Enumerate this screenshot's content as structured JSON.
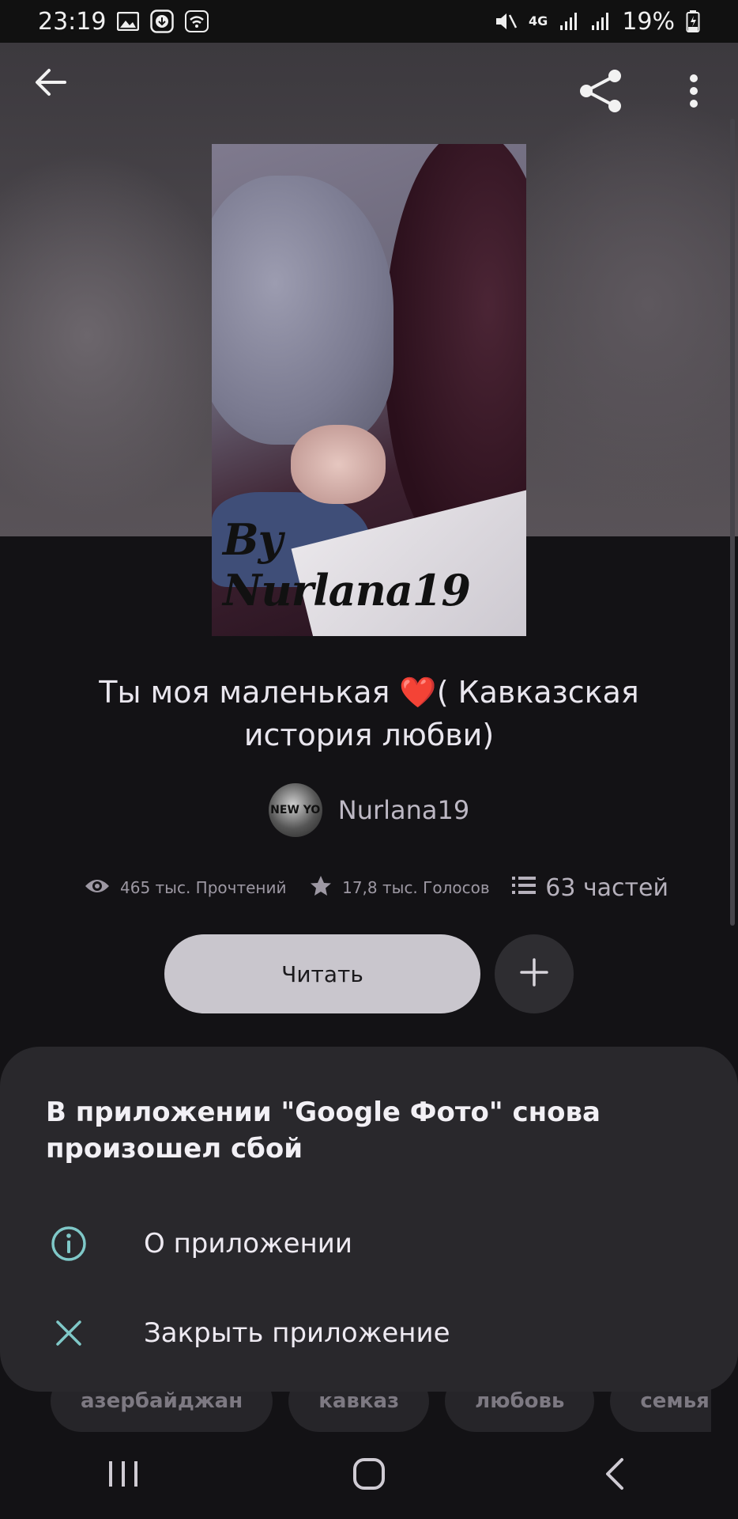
{
  "status_bar": {
    "time": "23:19",
    "left_icons": [
      "image-icon",
      "download-icon",
      "wifi-icon"
    ],
    "right_icons": [
      "mute-icon",
      "4g-icon",
      "signal-icon",
      "signal-icon",
      "battery-charging-icon"
    ],
    "network": "4G",
    "battery": "19%"
  },
  "top_bar": {
    "back_icon": "arrow-left-icon",
    "share_icon": "share-icon",
    "more_icon": "more-vertical-icon"
  },
  "cover": {
    "byline": "By Nurlana19"
  },
  "story": {
    "title": "Ты моя маленькая ❤️( Кавказская история любви)",
    "author": "Nurlana19",
    "avatar_text": "NEW YO"
  },
  "stats": {
    "reads": "465 тыс. Прочтений",
    "votes": "17,8 тыс. Голосов",
    "parts": "63 частей"
  },
  "actions": {
    "read_label": "Читать",
    "add_icon": "plus-icon"
  },
  "tags": [
    "азербайджан",
    "кавказ",
    "любовь",
    "семья"
  ],
  "dialog": {
    "title": "В приложении \"Google Фото\" снова произошел сбой",
    "items": [
      {
        "label": "О приложении",
        "icon": "info-icon"
      },
      {
        "label": "Закрыть приложение",
        "icon": "close-icon"
      }
    ],
    "accent": "#7fc8c8"
  },
  "nav_bar": {
    "icons": [
      "recent-apps-icon",
      "home-icon",
      "back-icon"
    ]
  },
  "colors": {
    "background": "#131215",
    "sheet": "#29282c",
    "read_button": "#c9c6cd"
  }
}
